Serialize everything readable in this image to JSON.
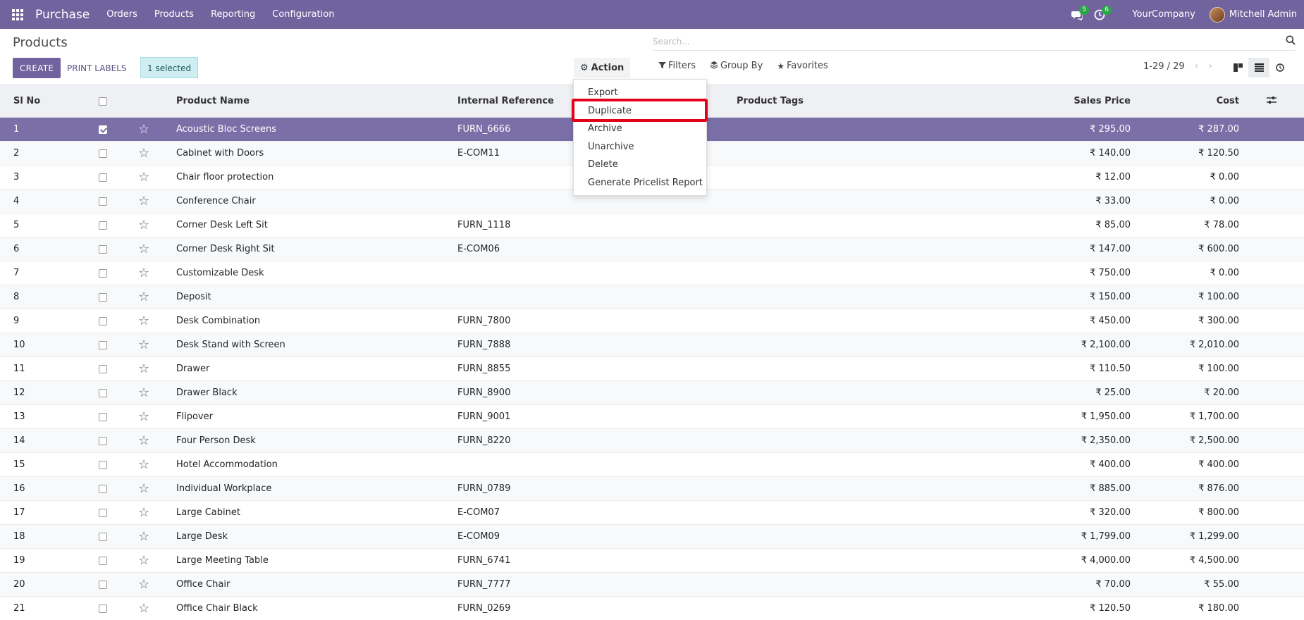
{
  "navbar": {
    "brand": "Purchase",
    "menu": [
      "Orders",
      "Products",
      "Reporting",
      "Configuration"
    ],
    "messages_count": "5",
    "activities_count": "6",
    "company": "YourCompany",
    "user": "Mitchell Admin",
    "bg_color": "#71639e"
  },
  "control_panel": {
    "title": "Products",
    "create_label": "CREATE",
    "print_labels_label": "PRINT LABELS",
    "selected_text": "1 selected",
    "action_label": "Action",
    "search_placeholder": "Search...",
    "filters_label": "Filters",
    "group_by_label": "Group By",
    "favorites_label": "Favorites",
    "pager_text": "1-29 / 29"
  },
  "action_menu": {
    "items": [
      "Export",
      "Duplicate",
      "Archive",
      "Unarchive",
      "Delete",
      "Generate Pricelist Report"
    ],
    "highlighted": "Duplicate"
  },
  "table": {
    "headers": {
      "sl_no": "Sl No",
      "product_name": "Product Name",
      "internal_reference": "Internal Reference",
      "product_tags": "Product Tags",
      "sales_price": "Sales Price",
      "cost": "Cost"
    },
    "rows": [
      {
        "sl": "1",
        "name": "Acoustic Bloc Screens",
        "ref": "FURN_6666",
        "price": "₹ 295.00",
        "cost": "₹ 287.00",
        "selected": true
      },
      {
        "sl": "2",
        "name": "Cabinet with Doors",
        "ref": "E-COM11",
        "price": "₹ 140.00",
        "cost": "₹ 120.50"
      },
      {
        "sl": "3",
        "name": "Chair floor protection",
        "ref": "",
        "price": "₹ 12.00",
        "cost": "₹ 0.00"
      },
      {
        "sl": "4",
        "name": "Conference Chair",
        "ref": "",
        "price": "₹ 33.00",
        "cost": "₹ 0.00"
      },
      {
        "sl": "5",
        "name": "Corner Desk Left Sit",
        "ref": "FURN_1118",
        "price": "₹ 85.00",
        "cost": "₹ 78.00"
      },
      {
        "sl": "6",
        "name": "Corner Desk Right Sit",
        "ref": "E-COM06",
        "price": "₹ 147.00",
        "cost": "₹ 600.00"
      },
      {
        "sl": "7",
        "name": "Customizable Desk",
        "ref": "",
        "price": "₹ 750.00",
        "cost": "₹ 0.00"
      },
      {
        "sl": "8",
        "name": "Deposit",
        "ref": "",
        "price": "₹ 150.00",
        "cost": "₹ 100.00"
      },
      {
        "sl": "9",
        "name": "Desk Combination",
        "ref": "FURN_7800",
        "price": "₹ 450.00",
        "cost": "₹ 300.00"
      },
      {
        "sl": "10",
        "name": "Desk Stand with Screen",
        "ref": "FURN_7888",
        "price": "₹ 2,100.00",
        "cost": "₹ 2,010.00"
      },
      {
        "sl": "11",
        "name": "Drawer",
        "ref": "FURN_8855",
        "price": "₹ 110.50",
        "cost": "₹ 100.00"
      },
      {
        "sl": "12",
        "name": "Drawer Black",
        "ref": "FURN_8900",
        "price": "₹ 25.00",
        "cost": "₹ 20.00"
      },
      {
        "sl": "13",
        "name": "Flipover",
        "ref": "FURN_9001",
        "price": "₹ 1,950.00",
        "cost": "₹ 1,700.00"
      },
      {
        "sl": "14",
        "name": "Four Person Desk",
        "ref": "FURN_8220",
        "price": "₹ 2,350.00",
        "cost": "₹ 2,500.00"
      },
      {
        "sl": "15",
        "name": "Hotel Accommodation",
        "ref": "",
        "price": "₹ 400.00",
        "cost": "₹ 400.00"
      },
      {
        "sl": "16",
        "name": "Individual Workplace",
        "ref": "FURN_0789",
        "price": "₹ 885.00",
        "cost": "₹ 876.00"
      },
      {
        "sl": "17",
        "name": "Large Cabinet",
        "ref": "E-COM07",
        "price": "₹ 320.00",
        "cost": "₹ 800.00"
      },
      {
        "sl": "18",
        "name": "Large Desk",
        "ref": "E-COM09",
        "price": "₹ 1,799.00",
        "cost": "₹ 1,299.00"
      },
      {
        "sl": "19",
        "name": "Large Meeting Table",
        "ref": "FURN_6741",
        "price": "₹ 4,000.00",
        "cost": "₹ 4,500.00"
      },
      {
        "sl": "20",
        "name": "Office Chair",
        "ref": "FURN_7777",
        "price": "₹ 70.00",
        "cost": "₹ 55.00"
      },
      {
        "sl": "21",
        "name": "Office Chair Black",
        "ref": "FURN_0269",
        "price": "₹ 120.50",
        "cost": "₹ 180.00"
      }
    ]
  }
}
